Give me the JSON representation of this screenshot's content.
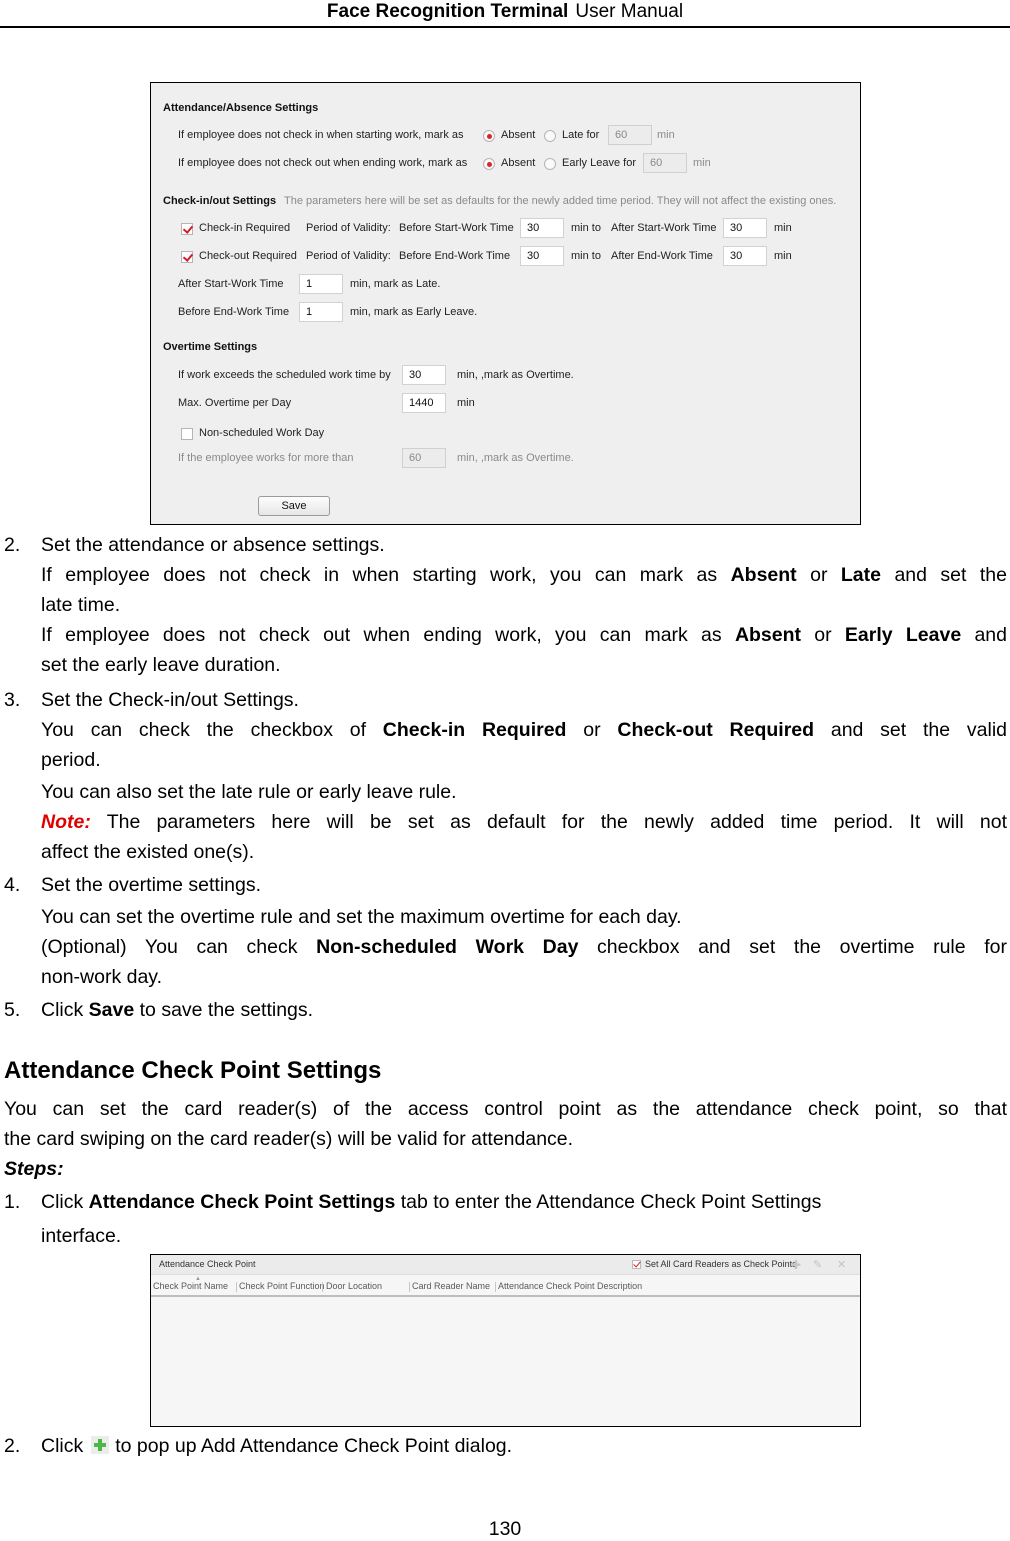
{
  "header": {
    "title_bold": "Face Recognition Terminal",
    "title_light": "User Manual"
  },
  "settings_panel": {
    "attendance": {
      "title": "Attendance/Absence Settings",
      "check_in_label": "If employee does not check in when starting work, mark as",
      "check_in_absent": "Absent",
      "check_in_late": "Late for",
      "check_in_late_value": "60",
      "check_in_selected": "Absent",
      "check_out_label": "If employee does not check out when ending work, mark as",
      "check_out_absent": "Absent",
      "check_out_early": "Early Leave for",
      "check_out_early_value": "60",
      "check_out_selected": "Absent",
      "unit": "min"
    },
    "checkinout": {
      "title": "Check-in/out Settings",
      "hint": "The parameters here will be set as defaults for the newly added time period. They will not affect the existing ones.",
      "checkin_required": {
        "label": "Check-in Required",
        "checked": true,
        "validity": "Period of Validity:",
        "before_label": "Before Start-Work Time",
        "before_value": "30",
        "to": "min  to",
        "after_label": "After Start-Work Time",
        "after_value": "30",
        "unit": "min"
      },
      "checkout_required": {
        "label": "Check-out Required",
        "checked": true,
        "validity": "Period of Validity:",
        "before_label": "Before End-Work Time",
        "before_value": "30",
        "to": "min  to",
        "after_label": "After End-Work Time",
        "after_value": "30",
        "unit": "min"
      },
      "late_rule": {
        "label": "After Start-Work Time",
        "value": "1",
        "suffix": "min,  mark as Late."
      },
      "early_rule": {
        "label": "Before End-Work Time",
        "value": "1",
        "suffix": "min,  mark as Early Leave."
      }
    },
    "overtime": {
      "title": "Overtime Settings",
      "exceed_label": "If work exceeds the scheduled work time by",
      "exceed_value": "30",
      "exceed_suffix": "min,  ,mark as Overtime.",
      "max_label": "Max. Overtime per Day",
      "max_value": "1440",
      "max_suffix": "min",
      "non_scheduled_label": "Non-scheduled Work Day",
      "non_scheduled_checked": false,
      "more_than_label": "If the employee works for more than",
      "more_than_value": "60",
      "more_than_suffix": "min,  ,mark as Overtime."
    },
    "save_label": "Save"
  },
  "body": {
    "step2": {
      "num": "2.",
      "title": "Set the attendance or absence settings.",
      "p1_a": "If employee does not check in when starting work, you can mark as ",
      "p1_b1": "Absent",
      "p1_c": " or ",
      "p1_b2": "Late",
      "p1_d": " and set the",
      "p1_e": "late time.",
      "p2_a": "If employee does not check out when ending work, you can mark as ",
      "p2_b1": "Absent",
      "p2_c": " or ",
      "p2_b2": "Early Leave",
      "p2_d": " and",
      "p2_e": "set the early leave duration."
    },
    "step3": {
      "num": "3.",
      "title": "Set the Check-in/out Settings.",
      "p1_a": "You can check the checkbox of ",
      "p1_b1": "Check-in Required",
      "p1_c": " or ",
      "p1_b2": "Check-out Required",
      "p1_d": " and set the valid",
      "p1_e": "period.",
      "p2": "You can also set the late rule or early leave rule.",
      "note_label": "Note:",
      "note_a": " The parameters here will be set as default for the newly added time period. It will not",
      "note_b": "affect the existed one(s)."
    },
    "step4": {
      "num": "4.",
      "title": "Set the overtime settings.",
      "p1": "You can set the overtime rule and set the maximum overtime for each day.",
      "p2_a": "(Optional) You can check ",
      "p2_b": "Non-scheduled Work Day",
      "p2_c": " checkbox and set the overtime rule for",
      "p2_d": "non-work day."
    },
    "step5": {
      "num": "5.",
      "a": "Click ",
      "b": "Save",
      "c": " to save the settings."
    },
    "section_heading": "Attendance Check Point Settings",
    "intro_a": "You can set the card reader(s) of the access control point as the attendance check point, so that",
    "intro_b": "the card swiping on the card reader(s) will be valid for attendance.",
    "steps_label": "Steps:",
    "s1": {
      "num": "1.",
      "a": "Click ",
      "b": "Attendance Check Point Settings",
      "c": " tab to enter the Attendance Check Point Settings",
      "d": "interface."
    },
    "s2": {
      "num": "2.",
      "a": "Click",
      "icon": "add-plus-icon",
      "c": "to pop up Add Attendance Check Point dialog."
    }
  },
  "checkpoint_panel": {
    "title": "Attendance Check Point",
    "set_all_label": "Set All Card Readers as Check Points",
    "set_all_checked": true,
    "tools": [
      "add-icon",
      "edit-icon",
      "delete-icon"
    ],
    "columns": [
      "Check Point Name",
      "Check Point Function",
      "Door Location",
      "Card Reader Name",
      "Attendance Check Point Description"
    ],
    "rows": []
  },
  "footer": {
    "page_number": "130"
  }
}
